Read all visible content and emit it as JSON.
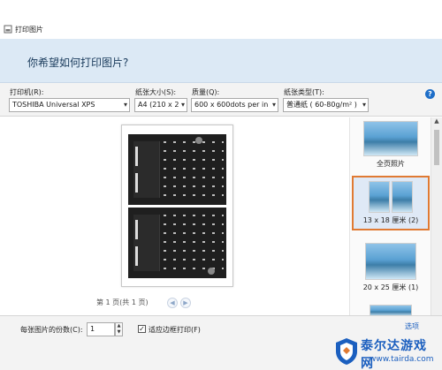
{
  "window": {
    "title": "打印图片"
  },
  "header": {
    "question": "你希望如何打印图片?"
  },
  "controls": {
    "printer": {
      "label": "打印机(R):",
      "value": "TOSHIBA Universal XPS"
    },
    "paper_size": {
      "label": "纸张大小(S):",
      "value": "A4 (210 x 2"
    },
    "quality": {
      "label": "质量(Q):",
      "value": "600 x 600dots per in"
    },
    "paper_type": {
      "label": "纸张类型(T):",
      "value": "普通纸 ( 60-80g/m² )"
    },
    "help_symbol": "?"
  },
  "preview": {
    "page_info": "第 1 页(共 1 页)",
    "prev_symbol": "◀",
    "next_symbol": "▶"
  },
  "layouts": [
    {
      "label": "全页照片",
      "selected": false
    },
    {
      "label": "13 x 18 厘米 (2)",
      "selected": true
    },
    {
      "label": "20 x 25 厘米 (1)",
      "selected": false
    },
    {
      "label": "选项",
      "selected": false
    }
  ],
  "footer": {
    "copies_label": "每张图片的份数(C):",
    "copies_value": "1",
    "fit_label": "适应边框打印(F)",
    "fit_checked": true,
    "check_symbol": "✓"
  },
  "watermark": {
    "brand": "泰尔达游戏网",
    "url": "www.tairda.com"
  },
  "colors": {
    "accent_selected": "#e07a33",
    "header_bg": "#dce9f5",
    "help_blue": "#1e6ec8"
  },
  "icons": [
    "photo-app-icon",
    "help-icon",
    "chevron-down-icon",
    "prev-page-icon",
    "next-page-icon",
    "checkbox-icon",
    "spin-up-icon",
    "spin-down-icon",
    "scroll-up-icon"
  ]
}
